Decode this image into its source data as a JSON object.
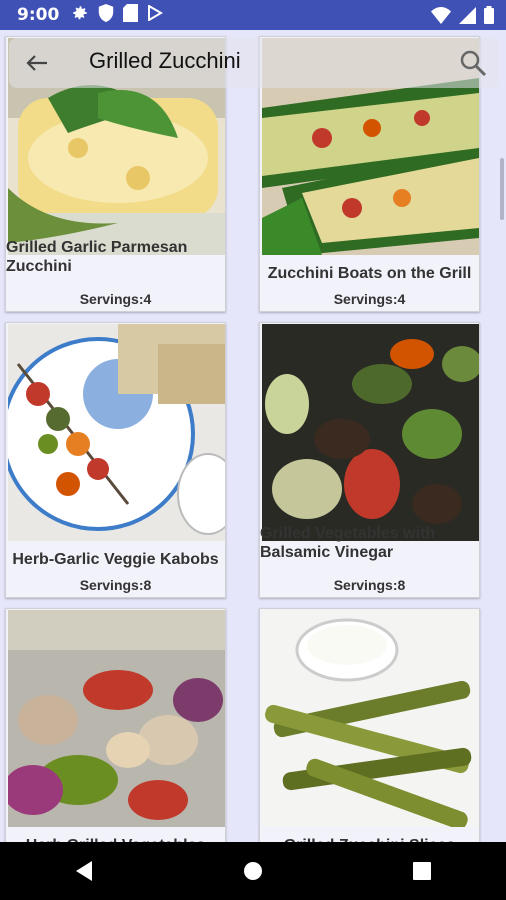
{
  "status": {
    "time": "9:00",
    "icons_left": [
      "gear-icon",
      "shield-icon",
      "sd-card-icon",
      "play-store-icon"
    ],
    "icons_right": [
      "wifi-icon",
      "signal-icon",
      "battery-icon"
    ]
  },
  "search": {
    "query": "Grilled Zucchini"
  },
  "recipes": [
    {
      "title": "Grilled Garlic Parmesan Zucchini",
      "servings": "Servings:4",
      "image": "zucchini-parmesan"
    },
    {
      "title": "Zucchini Boats on the Grill",
      "servings": "Servings:4",
      "image": "zucchini-boats"
    },
    {
      "title": "Herb-Garlic Veggie Kabobs",
      "servings": "Servings:8",
      "image": "veggie-kabobs"
    },
    {
      "title": "Grilled Vegetables with Balsamic Vinegar",
      "servings": "Servings:8",
      "image": "grilled-vegetables"
    },
    {
      "title": "Herb Grilled Vegetables",
      "servings": "",
      "image": "herb-vegetables"
    },
    {
      "title": "Grilled Zucchini Slices",
      "servings": "",
      "image": "zucchini-slices"
    }
  ],
  "nav": [
    "back-triangle-icon",
    "home-circle-icon",
    "recents-square-icon"
  ],
  "colors": {
    "statusbar": "#3F51B5",
    "background": "#E6E6FA",
    "card": "#F2F2FA"
  }
}
